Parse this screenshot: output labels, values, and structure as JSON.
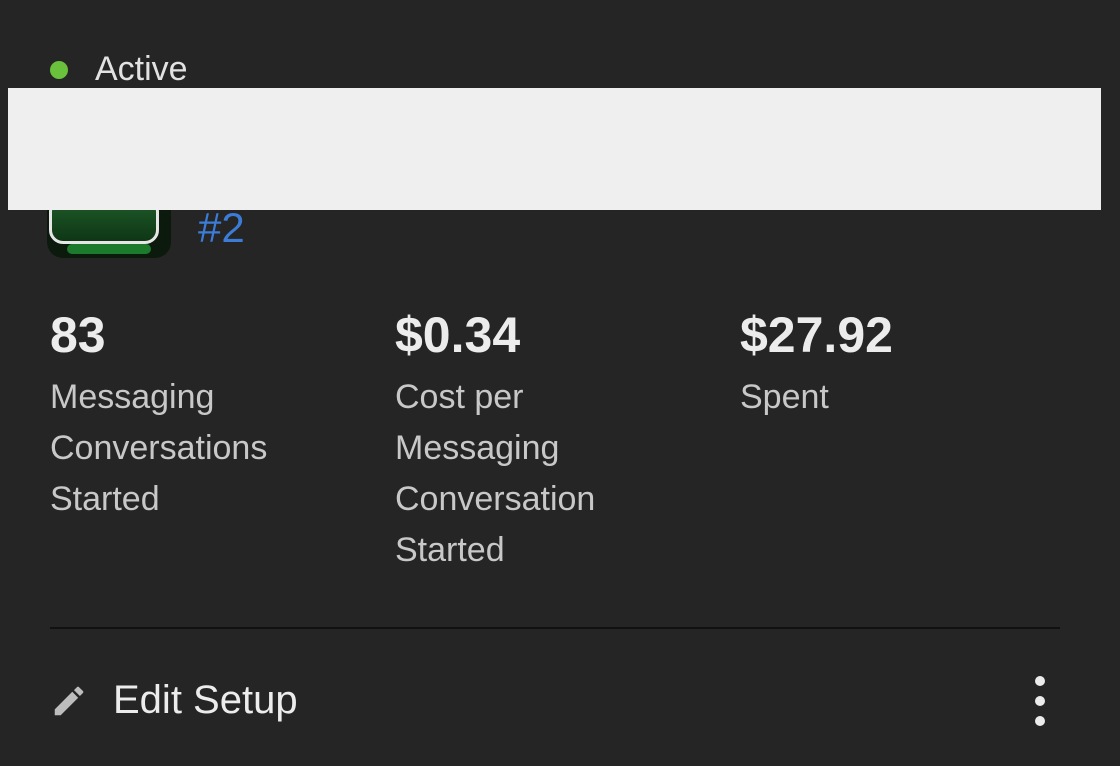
{
  "status": {
    "label": "Active",
    "color": "#6ac13c"
  },
  "ad": {
    "number": "#2",
    "link_color": "#3c7bd6"
  },
  "metrics": [
    {
      "value": "83",
      "label": "Messaging\nConversations\nStarted"
    },
    {
      "value": "$0.34",
      "label": "Cost per\nMessaging\nConversation\nStarted"
    },
    {
      "value": "$27.92",
      "label": "Spent"
    }
  ],
  "actions": {
    "edit_label": "Edit Setup",
    "edit_icon": "pencil-icon",
    "more_icon": "more-vertical-icon"
  }
}
